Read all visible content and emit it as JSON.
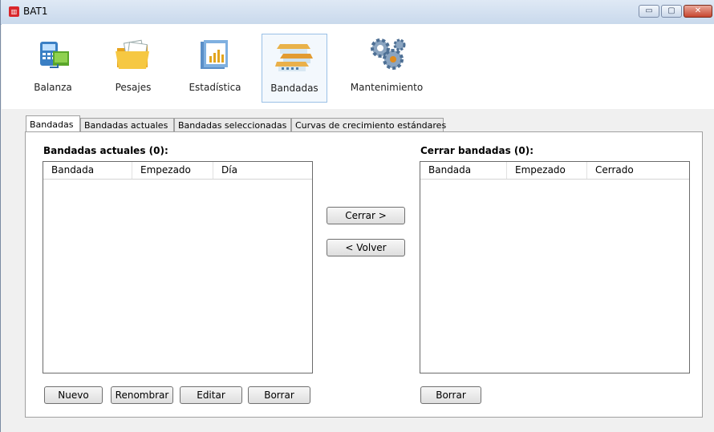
{
  "window": {
    "title": "BAT1",
    "app_icon": "bat1-app-icon",
    "controls": {
      "minimize": "▭",
      "maximize": "▢",
      "close": "✕"
    }
  },
  "ribbon": [
    {
      "label": "Balanza",
      "icon": "scale-icon"
    },
    {
      "label": "Pesajes",
      "icon": "folder-icon"
    },
    {
      "label": "Estadística",
      "icon": "statistics-icon"
    },
    {
      "label": "Bandadas",
      "icon": "farm-icon",
      "selected": true
    },
    {
      "label": "Mantenimiento",
      "icon": "gears-icon"
    }
  ],
  "tabs": [
    {
      "label": "Bandadas",
      "active": true
    },
    {
      "label": "Bandadas actuales"
    },
    {
      "label": "Bandadas seleccionadas"
    },
    {
      "label": "Curvas de crecimiento estándares"
    }
  ],
  "left": {
    "header": "Bandadas actuales (0):",
    "columns": [
      "Bandada",
      "Empezado",
      "Día"
    ],
    "buttons": [
      "Nuevo",
      "Renombrar",
      "Editar",
      "Borrar"
    ]
  },
  "middle": {
    "close_label": "Cerrar  >",
    "back_label": "<  Volver"
  },
  "right": {
    "header": "Cerrar bandadas (0):",
    "columns": [
      "Bandada",
      "Empezado",
      "Cerrado"
    ],
    "buttons": [
      "Borrar"
    ]
  }
}
